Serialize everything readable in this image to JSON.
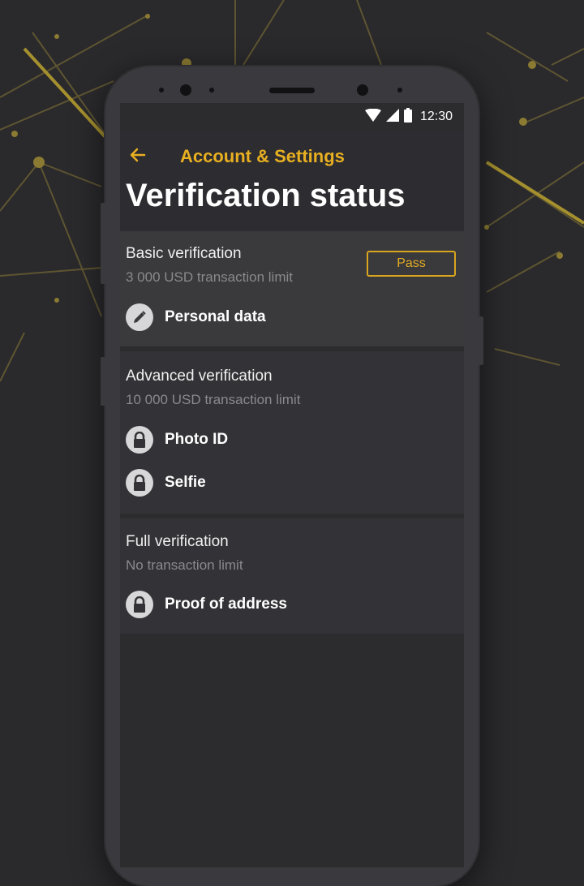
{
  "status_bar": {
    "time": "12:30",
    "icons": [
      "wifi-icon",
      "signal-icon",
      "battery-icon"
    ]
  },
  "header": {
    "back_icon": "back-arrow-icon",
    "nav_title": "Account & Settings",
    "page_title": "Verification status"
  },
  "colors": {
    "accent": "#e8b021",
    "background": "#2a292c",
    "card_basic": "#3a393c",
    "card_other": "#333236"
  },
  "cards": [
    {
      "title": "Basic verification",
      "subtitle": "3 000 USD transaction limit",
      "action_label": "Pass",
      "items": [
        {
          "icon": "pencil-icon",
          "label": "Personal data"
        }
      ]
    },
    {
      "title": "Advanced verification",
      "subtitle": "10 000 USD transaction limit",
      "items": [
        {
          "icon": "lock-icon",
          "label": "Photo ID"
        },
        {
          "icon": "lock-icon",
          "label": "Selfie"
        }
      ]
    },
    {
      "title": "Full verification",
      "subtitle": "No transaction limit",
      "items": [
        {
          "icon": "lock-icon",
          "label": "Proof of address"
        }
      ]
    }
  ]
}
